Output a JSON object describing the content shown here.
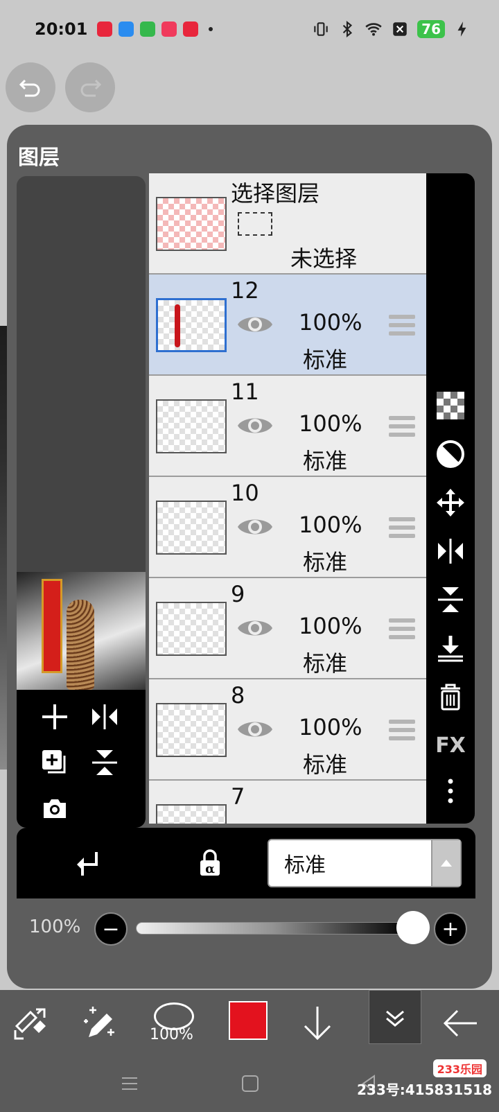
{
  "status": {
    "time": "20:01",
    "battery": "76",
    "app_icon_colors": [
      "#e8263c",
      "#2a8cf0",
      "#35b84c",
      "#f03a5c",
      "#e8263c"
    ]
  },
  "panel": {
    "title": "图层"
  },
  "selection_layer": {
    "title": "选择图层",
    "status": "未选择"
  },
  "layers": [
    {
      "number": "12",
      "opacity": "100%",
      "blend": "标准",
      "selected": true
    },
    {
      "number": "11",
      "opacity": "100%",
      "blend": "标准",
      "selected": false
    },
    {
      "number": "10",
      "opacity": "100%",
      "blend": "标准",
      "selected": false
    },
    {
      "number": "9",
      "opacity": "100%",
      "blend": "标准",
      "selected": false
    },
    {
      "number": "8",
      "opacity": "100%",
      "blend": "标准",
      "selected": false
    },
    {
      "number": "7",
      "opacity": "",
      "blend": "",
      "selected": false
    }
  ],
  "right_strip": {
    "fx_label": "FX"
  },
  "blend_bar": {
    "mode": "标准"
  },
  "opacity_row": {
    "label": "100%",
    "value": 1.0
  },
  "toolbar": {
    "brush_size": "100%",
    "color": "#e3121e"
  },
  "navbar": {
    "watermark": "233号:415831518",
    "badge": "233乐园"
  },
  "colors": {
    "panel_bg": "#5d5d5d",
    "selected_layer": "#cdd9ec",
    "accent_blue": "#2e6fd0"
  }
}
